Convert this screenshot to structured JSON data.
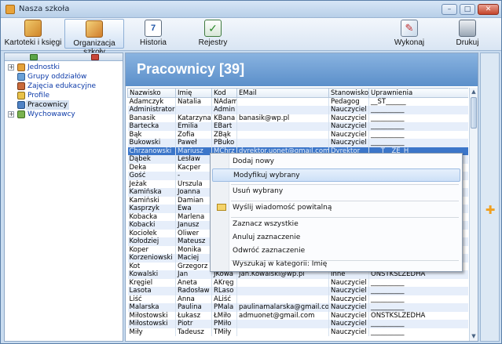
{
  "window": {
    "title": "Nasza szkoła"
  },
  "toolbar": {
    "kartoteki": "Kartoteki i księgi",
    "organizacja": "Organizacja szkoły",
    "historia": "Historia",
    "historia_day": "7",
    "rejestry": "Rejestry",
    "wykonaj": "Wykonaj",
    "drukuj": "Drukuj"
  },
  "tree": [
    {
      "label": "Jednostki",
      "expandable": true
    },
    {
      "label": "Grupy oddziałów",
      "expandable": false
    },
    {
      "label": "Zajęcia edukacyjne",
      "expandable": false
    },
    {
      "label": "Profile",
      "expandable": false
    },
    {
      "label": "Pracownicy",
      "expandable": false,
      "selected": true
    },
    {
      "label": "Wychowawcy",
      "expandable": true
    }
  ],
  "main": {
    "title": "Pracownicy [39]"
  },
  "table": {
    "columns": [
      "Nazwisko",
      "Imię",
      "Kod",
      "EMail",
      "Stanowisko",
      "Uprawnienia"
    ],
    "rows": [
      [
        "Adamczyk",
        "Natalia",
        "NAdam",
        "",
        "Pedagog",
        "__ST______"
      ],
      [
        "Administrator",
        "",
        "Admin",
        "",
        "Nauczyciel",
        "__________"
      ],
      [
        "Banasik",
        "Katarzyna",
        "KBana",
        "banasik@wp.pl",
        "Nauczyciel",
        "__________"
      ],
      [
        "Bartecka",
        "Emilia",
        "EBart",
        "",
        "Nauczyciel",
        "__________"
      ],
      [
        "Bąk",
        "Zofia",
        "ZBąk",
        "",
        "Nauczyciel",
        "__________"
      ],
      [
        "Bukowski",
        "Paweł",
        "PBuko",
        "",
        "Nauczyciel",
        "__________"
      ],
      [
        "Chrzanowski",
        "Mariusz",
        "MChrz",
        "dyrektor.uonet@gmail.com",
        "Dyrektor",
        "___T__ZE_H"
      ],
      [
        "Dąbek",
        "Lesław",
        "",
        "",
        "",
        ""
      ],
      [
        "Deka",
        "Kacper",
        "",
        "",
        "",
        ""
      ],
      [
        "Gość",
        "-",
        "",
        "",
        "",
        ""
      ],
      [
        "Jeżak",
        "Urszula",
        "",
        "",
        "",
        ""
      ],
      [
        "Kamińska",
        "Joanna",
        "",
        "",
        "",
        ""
      ],
      [
        "Kamiński",
        "Damian",
        "",
        "",
        "",
        ""
      ],
      [
        "Kasprzyk",
        "Ewa",
        "",
        "",
        "",
        ""
      ],
      [
        "Kobacka",
        "Marlena",
        "",
        "",
        "",
        ""
      ],
      [
        "Kobacki",
        "Janusz",
        "",
        "",
        "",
        ""
      ],
      [
        "Kociołek",
        "Oliwer",
        "",
        "",
        "",
        ""
      ],
      [
        "Kołodziej",
        "Mateusz",
        "",
        "",
        "",
        ""
      ],
      [
        "Koper",
        "Monika",
        "",
        "",
        "",
        ""
      ],
      [
        "Korzeniowski",
        "Maciej",
        "",
        "",
        "",
        ""
      ],
      [
        "Kot",
        "Grzegorz",
        "",
        "",
        "",
        ""
      ],
      [
        "Kowalski",
        "Jan",
        "JKowa",
        "Jan.Kowalski@wp.pl",
        "Inne",
        "ONSTKSLZEDHA"
      ],
      [
        "Kręgiel",
        "Aneta",
        "AKręg",
        "",
        "Nauczyciel",
        "__________"
      ],
      [
        "Lasota",
        "Radosław",
        "RLaso",
        "",
        "Nauczyciel",
        "__________"
      ],
      [
        "Liść",
        "Anna",
        "ALiść",
        "",
        "Nauczyciel",
        "__________"
      ],
      [
        "Malarska",
        "Paulina",
        "PMala",
        "paulinamalarska@gmail.com",
        "Nauczyciel",
        "__________"
      ],
      [
        "Miłostowski",
        "Łukasz",
        "ŁMiło",
        "admuonet@gmail.com",
        "Nauczyciel",
        "ONSTKSLZEDHA"
      ],
      [
        "Miłostowski",
        "Piotr",
        "PMiło",
        "",
        "Nauczyciel",
        "__________"
      ],
      [
        "Miły",
        "Tadeusz",
        "TMiły",
        "",
        "Nauczyciel",
        "__________"
      ]
    ]
  },
  "context_menu": {
    "items": [
      "Dodaj nowy",
      "Modyfikuj wybrany",
      "Usuń wybrany",
      "Wyślij wiadomość powitalną",
      "Zaznacz wszystkie",
      "Anuluj zaznaczenie",
      "Odwróć zaznaczenie",
      "Wyszukaj w kategorii: Imię"
    ]
  }
}
